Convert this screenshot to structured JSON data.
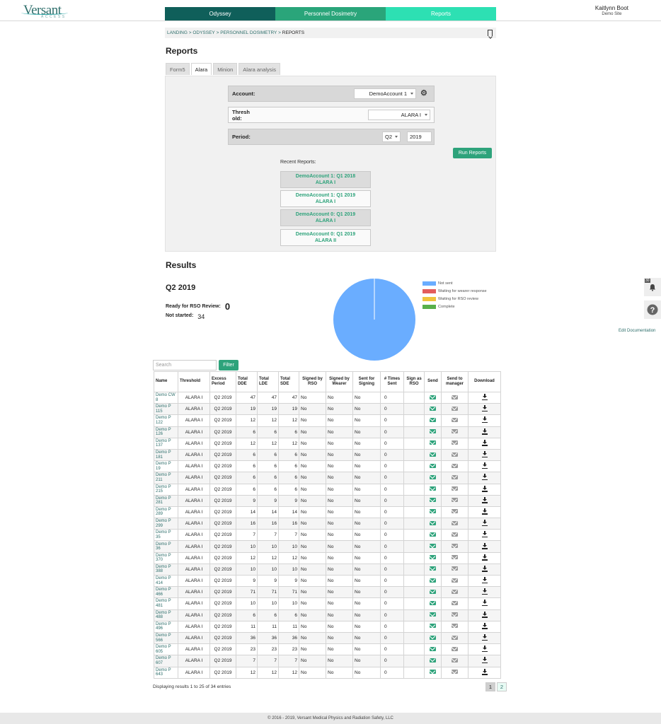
{
  "brand": {
    "logo": "Versant",
    "logo_sub": "ACCESS"
  },
  "nav": [
    {
      "label": "Odyssey",
      "color": "#0f5f5a"
    },
    {
      "label": "Personnel Dosimetry",
      "color": "#2aa57a"
    },
    {
      "label": "Reports",
      "color": "#2de0b3"
    }
  ],
  "user": {
    "name": "Kaitlynn Boot",
    "site": "Demo Site"
  },
  "breadcrumb": {
    "items": [
      "LANDING",
      "ODYSSEY",
      "PERSONNEL DOSIMETRY"
    ],
    "current": "REPORTS",
    "sep": " > "
  },
  "page_title": "Reports",
  "tabs": [
    "Form5",
    "Alara",
    "Minion",
    "Alara analysis"
  ],
  "form": {
    "account_label": "Account:",
    "account_value": "DemoAccount 1",
    "threshold_label": "Thresh old:",
    "threshold_value": "ALARA I",
    "period_label": "Period:",
    "period_quarter": "Q2",
    "period_year": "2019",
    "run_button": "Run Reports",
    "recent_label": "Recent Reports:",
    "recent": [
      {
        "line1": "DemoAccount 1: Q1 2018",
        "line2": "ALARA I"
      },
      {
        "line1": "DemoAccount 1: Q1 2019",
        "line2": "ALARA I"
      },
      {
        "line1": "DemoAccount 0: Q1 2019",
        "line2": "ALARA I"
      },
      {
        "line1": "DemoAccount 0: Q1 2019",
        "line2": "ALARA II"
      }
    ]
  },
  "results": {
    "title": "Results",
    "period": "Q2 2019",
    "rso_label": "Ready for RSO Review:",
    "rso_value": "0",
    "ns_label": "Not started:",
    "ns_value": "34"
  },
  "chart_data": {
    "type": "pie",
    "categories": [
      "Not sent",
      "Waiting for wearer response",
      "Waiting for RSO review",
      "Complete"
    ],
    "values": [
      34,
      0,
      0,
      0
    ],
    "colors": [
      "#6aadff",
      "#e35d5d",
      "#f0c43d",
      "#58b04a"
    ],
    "legend": "right"
  },
  "side": {
    "badge": "30",
    "edit_doc": "Edit Documentation"
  },
  "table": {
    "search_placeholder": "Search",
    "filter_button": "Filter",
    "headers": [
      "Name",
      "Threshold",
      "Excess Period",
      "Total DDE",
      "Total LDE",
      "Total SDE",
      "Signed by RSO",
      "Signed by Wearer",
      "Sent for Signing",
      "# Times Sent",
      "Sign as RSO",
      "Send",
      "Send to manager",
      "Download"
    ],
    "rows": [
      [
        "Demo CW 8",
        "ALARA I",
        "Q2 2019",
        "47",
        "47",
        "47",
        "No",
        "No",
        "No",
        "0"
      ],
      [
        "Demo P 115",
        "ALARA I",
        "Q2 2019",
        "19",
        "19",
        "19",
        "No",
        "No",
        "No",
        "0"
      ],
      [
        "Demo P 122",
        "ALARA I",
        "Q2 2019",
        "12",
        "12",
        "12",
        "No",
        "No",
        "No",
        "0"
      ],
      [
        "Demo P 126",
        "ALARA I",
        "Q2 2019",
        "6",
        "6",
        "6",
        "No",
        "No",
        "No",
        "0"
      ],
      [
        "Demo P 137",
        "ALARA I",
        "Q2 2019",
        "12",
        "12",
        "12",
        "No",
        "No",
        "No",
        "0"
      ],
      [
        "Demo P 181",
        "ALARA I",
        "Q2 2019",
        "6",
        "6",
        "6",
        "No",
        "No",
        "No",
        "0"
      ],
      [
        "Demo P 19",
        "ALARA I",
        "Q2 2019",
        "6",
        "6",
        "6",
        "No",
        "No",
        "No",
        "0"
      ],
      [
        "Demo P 211",
        "ALARA I",
        "Q2 2019",
        "6",
        "6",
        "6",
        "No",
        "No",
        "No",
        "0"
      ],
      [
        "Demo P 215",
        "ALARA I",
        "Q2 2019",
        "6",
        "6",
        "6",
        "No",
        "No",
        "No",
        "0"
      ],
      [
        "Demo P 281",
        "ALARA I",
        "Q2 2019",
        "9",
        "9",
        "9",
        "No",
        "No",
        "No",
        "0"
      ],
      [
        "Demo P 289",
        "ALARA I",
        "Q2 2019",
        "14",
        "14",
        "14",
        "No",
        "No",
        "No",
        "0"
      ],
      [
        "Demo P 299",
        "ALARA I",
        "Q2 2019",
        "16",
        "16",
        "16",
        "No",
        "No",
        "No",
        "0"
      ],
      [
        "Demo P 35",
        "ALARA I",
        "Q2 2019",
        "7",
        "7",
        "7",
        "No",
        "No",
        "No",
        "0"
      ],
      [
        "Demo P 36",
        "ALARA I",
        "Q2 2019",
        "10",
        "10",
        "10",
        "No",
        "No",
        "No",
        "0"
      ],
      [
        "Demo P 370",
        "ALARA I",
        "Q2 2019",
        "12",
        "12",
        "12",
        "No",
        "No",
        "No",
        "0"
      ],
      [
        "Demo P 388",
        "ALARA I",
        "Q2 2019",
        "10",
        "10",
        "10",
        "No",
        "No",
        "No",
        "0"
      ],
      [
        "Demo P 414",
        "ALARA I",
        "Q2 2019",
        "9",
        "9",
        "9",
        "No",
        "No",
        "No",
        "0"
      ],
      [
        "Demo P 466",
        "ALARA I",
        "Q2 2019",
        "71",
        "71",
        "71",
        "No",
        "No",
        "No",
        "0"
      ],
      [
        "Demo P 481",
        "ALARA I",
        "Q2 2019",
        "10",
        "10",
        "10",
        "No",
        "No",
        "No",
        "0"
      ],
      [
        "Demo P 488",
        "ALARA I",
        "Q2 2019",
        "6",
        "6",
        "6",
        "No",
        "No",
        "No",
        "0"
      ],
      [
        "Demo P 496",
        "ALARA I",
        "Q2 2019",
        "11",
        "11",
        "11",
        "No",
        "No",
        "No",
        "0"
      ],
      [
        "Demo P 566",
        "ALARA I",
        "Q2 2019",
        "36",
        "36",
        "36",
        "No",
        "No",
        "No",
        "0"
      ],
      [
        "Demo P 605",
        "ALARA I",
        "Q2 2019",
        "23",
        "23",
        "23",
        "No",
        "No",
        "No",
        "0"
      ],
      [
        "Demo P 607",
        "ALARA I",
        "Q2 2019",
        "7",
        "7",
        "7",
        "No",
        "No",
        "No",
        "0"
      ],
      [
        "Demo P 643",
        "ALARA I",
        "Q2 2019",
        "12",
        "12",
        "12",
        "No",
        "No",
        "No",
        "0"
      ]
    ],
    "footer_text": "Displaying results 1 to 25 of 34 entries",
    "pages": [
      "1",
      "2"
    ]
  },
  "footer": "© 2016 - 2019, Versant Medical Physics and Radiation Safety, LLC"
}
